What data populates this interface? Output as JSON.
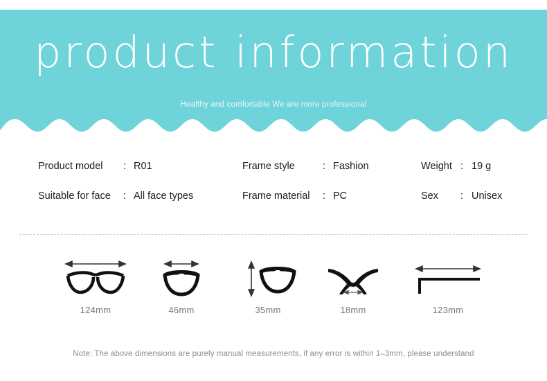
{
  "theme": {
    "banner_color": "#6FD3DA",
    "banner_text_color": "#FFFFFF",
    "subtitle_color": "#E8F8FA",
    "body_text_color": "#1C1C1C",
    "muted_text_color": "#757575",
    "note_text_color": "#8D8D8D",
    "divider_color": "#CFCFCF"
  },
  "banner": {
    "title": "product information",
    "subtitle": "Healthy and comfortable We are more professional"
  },
  "specs": {
    "rows": [
      {
        "cells": [
          {
            "label": "Product model",
            "colon": ":",
            "value": "R01"
          },
          {
            "label": "Frame style",
            "colon": ":",
            "value": "Fashion"
          },
          {
            "label": "Weight",
            "colon": ":",
            "value": "19 g"
          }
        ]
      },
      {
        "cells": [
          {
            "label": "Suitable for face",
            "colon": ":",
            "value": "All face types"
          },
          {
            "label": "Frame material",
            "colon": ":",
            "value": "PC"
          },
          {
            "label": "Sex",
            "colon": ":",
            "value": "Unisex"
          }
        ]
      }
    ]
  },
  "dimensions": {
    "items": [
      {
        "icon": "frame-total-width-icon",
        "label": "124mm"
      },
      {
        "icon": "lens-width-icon",
        "label": "46mm"
      },
      {
        "icon": "lens-height-icon",
        "label": "35mm"
      },
      {
        "icon": "bridge-width-icon",
        "label": "18mm"
      },
      {
        "icon": "temple-length-icon",
        "label": "123mm"
      }
    ]
  },
  "note": {
    "text": "Note: The above dimensions are purely manual measurements, if any error is within 1–3mm, please understand"
  }
}
